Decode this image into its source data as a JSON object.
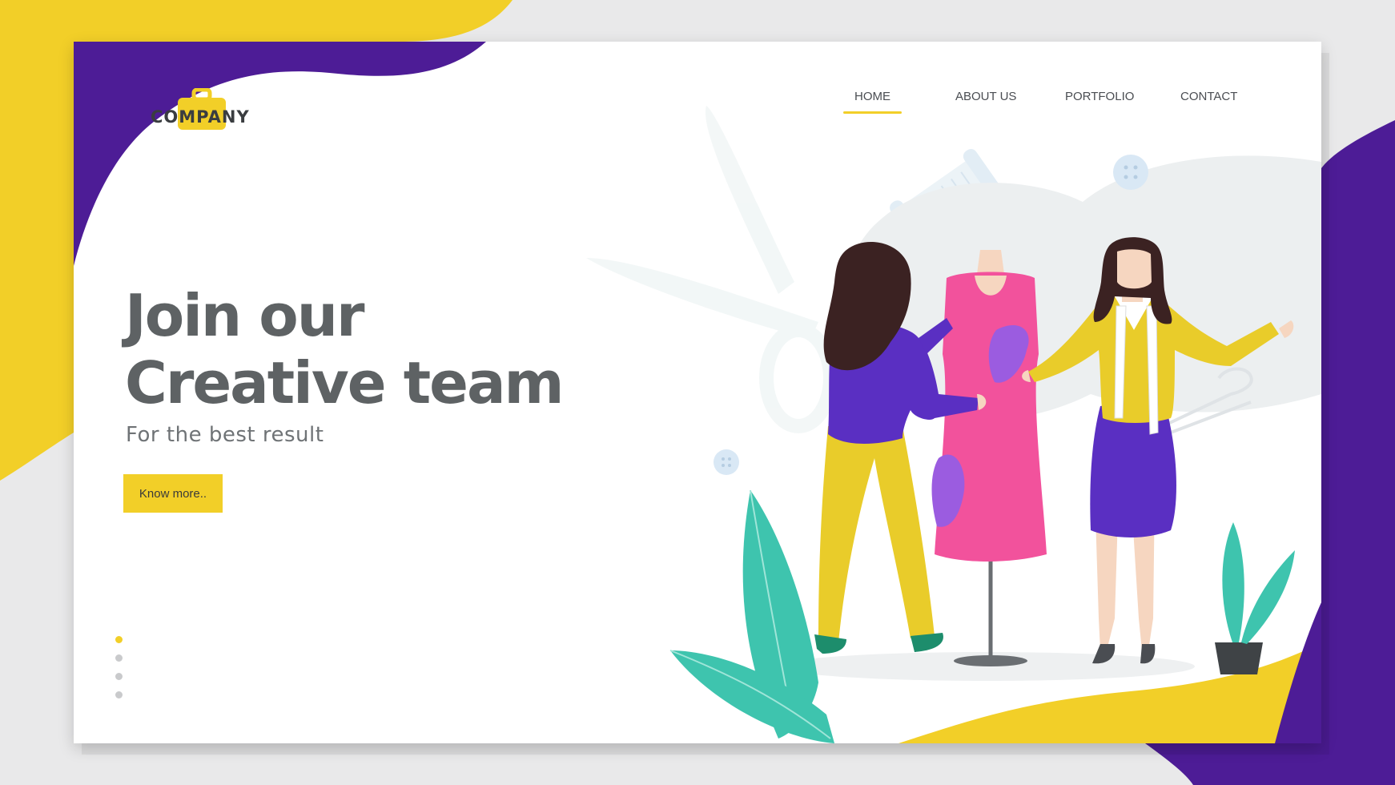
{
  "logo": {
    "text": "COMPANY",
    "icon": "briefcase-icon"
  },
  "nav": {
    "items": [
      {
        "label": "HOME",
        "active": true
      },
      {
        "label": "ABOUT US",
        "active": false
      },
      {
        "label": "PORTFOLIO",
        "active": false
      },
      {
        "label": "CONTACT",
        "active": false
      }
    ]
  },
  "hero": {
    "headline_line1": "Join our",
    "headline_line2": "Creative team",
    "subheadline": "For the best result",
    "cta_label": "Know more.."
  },
  "carousel": {
    "slide_count": 4,
    "active_index": 0
  },
  "colors": {
    "purple": "#4d1c96",
    "yellow": "#f2cf28",
    "dress_pink": "#f2529c",
    "teal": "#3ec4ae",
    "text_gray": "#5e6264"
  }
}
